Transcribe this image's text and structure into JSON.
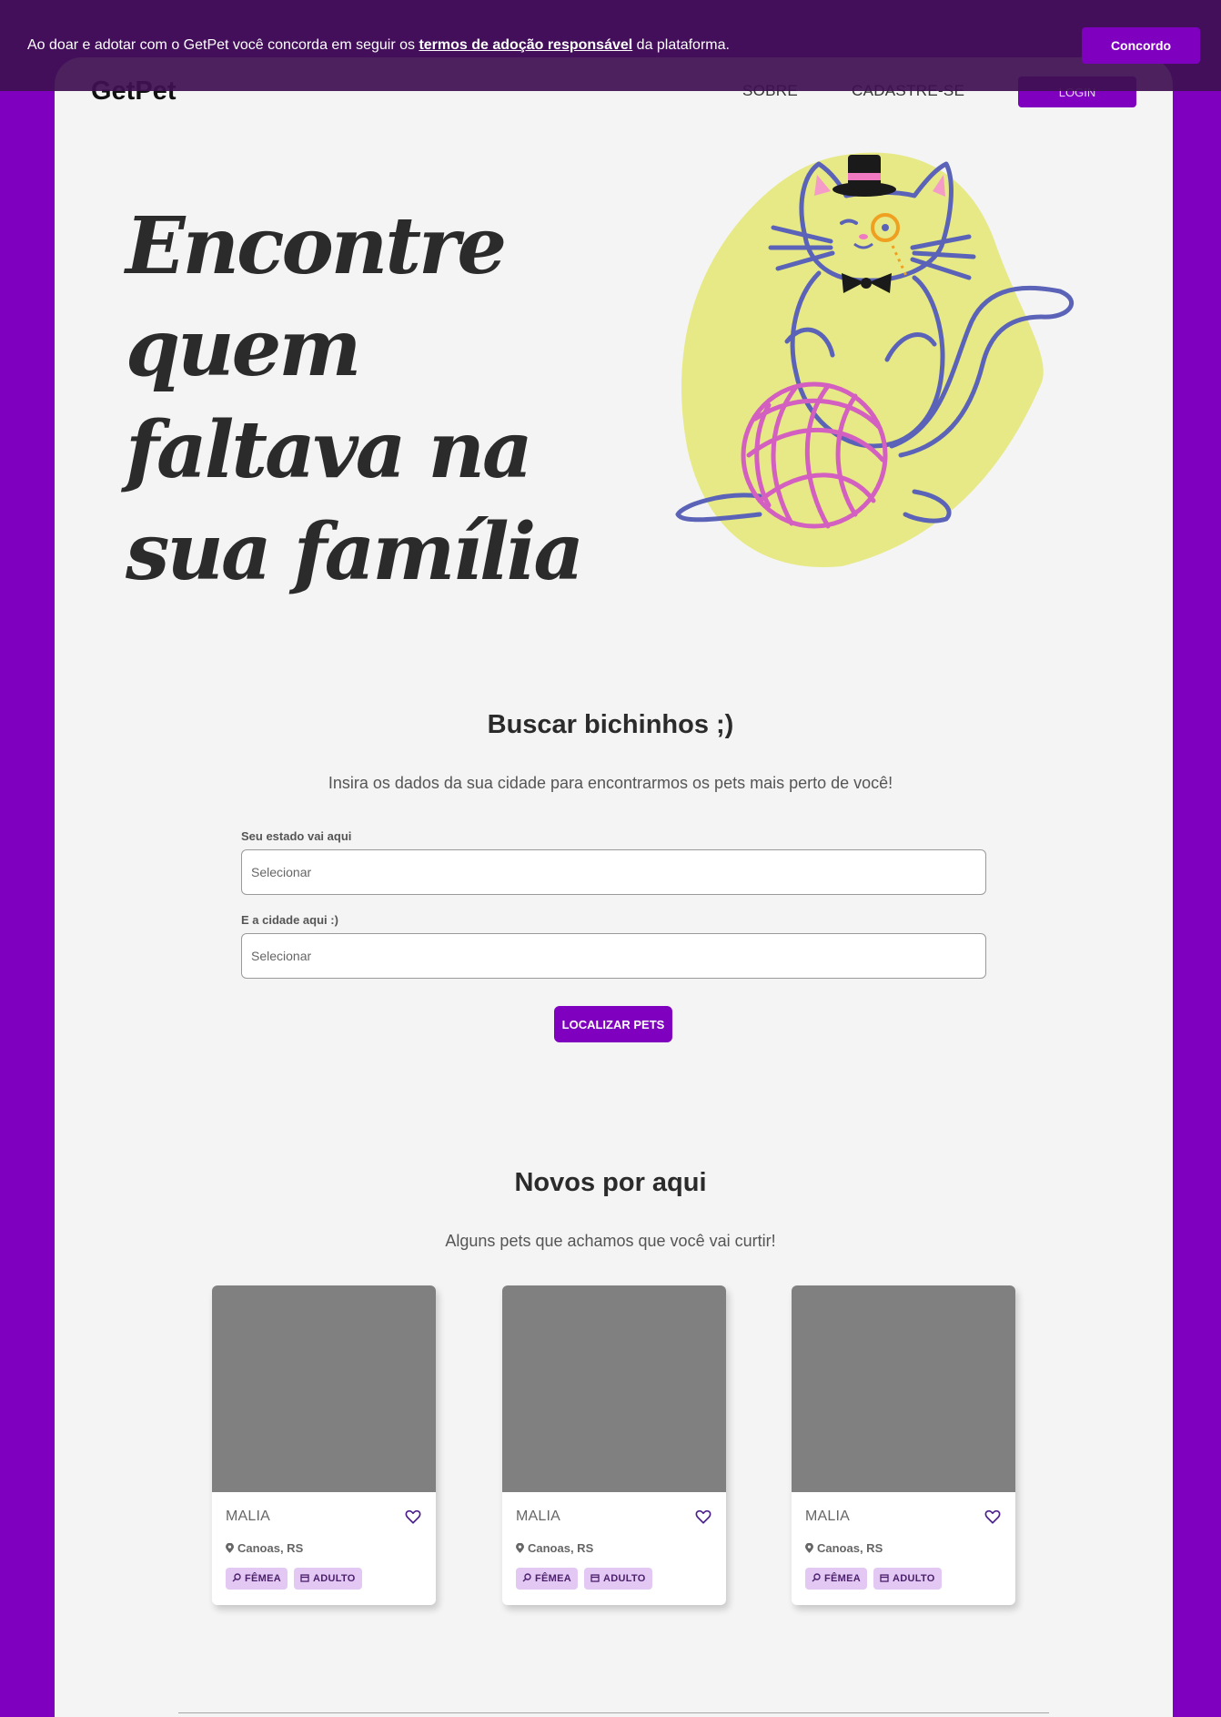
{
  "cookie": {
    "text_before": "Ao doar e adotar com o GetPet você concorda em seguir os ",
    "link": "termos de adoção responsável",
    "text_after": " da plataforma.",
    "button": "Concordo"
  },
  "header": {
    "logo": "GetPet",
    "nav": [
      "SOBRE",
      "CADASTRE-SE"
    ],
    "login": "LOGIN"
  },
  "hero": {
    "title": "Encontre quem faltava na sua família"
  },
  "search": {
    "title": "Buscar bichinhos ;)",
    "subtitle": "Insira os dados da sua cidade para encontrarmos os pets mais perto de você!",
    "state_label": "Seu estado vai aqui",
    "state_value": "Selecionar",
    "city_label": "E a cidade aqui :)",
    "city_value": "Selecionar",
    "button": "LOCALIZAR PETS"
  },
  "new_pets": {
    "title": "Novos por aqui",
    "subtitle": "Alguns pets que achamos que você vai curtir!",
    "cards": [
      {
        "name": "MALIA",
        "location": "Canoas, RS",
        "tags": [
          "FÊMEA",
          "ADULTO"
        ]
      },
      {
        "name": "MALIA",
        "location": "Canoas, RS",
        "tags": [
          "FÊMEA",
          "ADULTO"
        ]
      },
      {
        "name": "MALIA",
        "location": "Canoas, RS",
        "tags": [
          "FÊMEA",
          "ADULTO"
        ]
      }
    ]
  },
  "colors": {
    "brand": "#7f00bf",
    "banner": "#3e1052",
    "blob": "#e6e985",
    "cat_stroke": "#5b63b8",
    "yarn": "#d35fc0"
  }
}
